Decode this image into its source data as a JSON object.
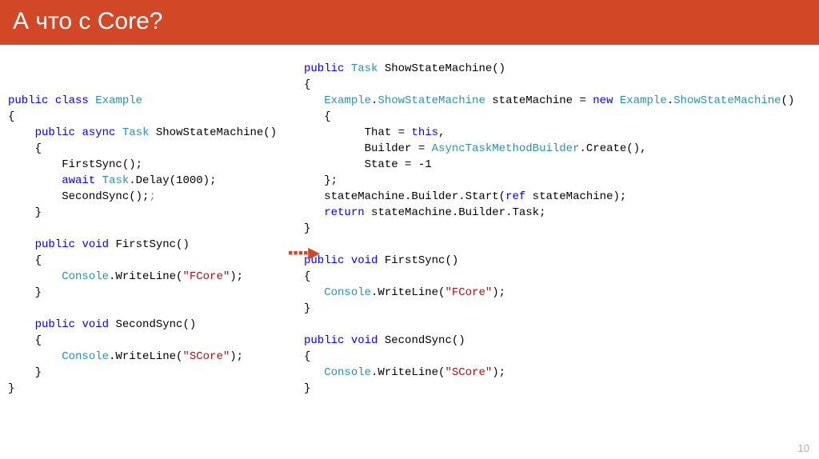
{
  "header": {
    "title": "А что с Core?"
  },
  "slide": {
    "page_number": "10"
  },
  "code": {
    "left": {
      "tokens": [
        {
          "t": "public",
          "c": "kw"
        },
        {
          "t": " "
        },
        {
          "t": "class",
          "c": "kw"
        },
        {
          "t": " "
        },
        {
          "t": "Example",
          "c": "type"
        },
        {
          "t": "\n"
        },
        {
          "t": "{\n"
        },
        {
          "t": "    "
        },
        {
          "t": "public",
          "c": "kw"
        },
        {
          "t": " "
        },
        {
          "t": "async",
          "c": "kw"
        },
        {
          "t": " "
        },
        {
          "t": "Task",
          "c": "type"
        },
        {
          "t": " ShowStateMachine()\n"
        },
        {
          "t": "    {\n"
        },
        {
          "t": "        FirstSync();\n"
        },
        {
          "t": "        "
        },
        {
          "t": "await",
          "c": "kw"
        },
        {
          "t": " "
        },
        {
          "t": "Task",
          "c": "type"
        },
        {
          "t": ".Delay(1000);\n"
        },
        {
          "t": "        SecondSync();"
        },
        {
          "t": ";",
          "c": "gray"
        },
        {
          "t": "\n"
        },
        {
          "t": "    }\n"
        },
        {
          "t": "\n"
        },
        {
          "t": "    "
        },
        {
          "t": "public",
          "c": "kw"
        },
        {
          "t": " "
        },
        {
          "t": "void",
          "c": "kw"
        },
        {
          "t": " FirstSync()\n"
        },
        {
          "t": "    {",
          "hl": true
        },
        {
          "t": "\n"
        },
        {
          "t": "        "
        },
        {
          "t": "Console",
          "c": "type"
        },
        {
          "t": ".WriteLine("
        },
        {
          "t": "\"FCore\"",
          "c": "str"
        },
        {
          "t": ");\n"
        },
        {
          "t": "    }\n"
        },
        {
          "t": "\n"
        },
        {
          "t": "    "
        },
        {
          "t": "public",
          "c": "kw"
        },
        {
          "t": " "
        },
        {
          "t": "void",
          "c": "kw"
        },
        {
          "t": " SecondSync()\n"
        },
        {
          "t": "    {\n"
        },
        {
          "t": "        "
        },
        {
          "t": "Console",
          "c": "type"
        },
        {
          "t": ".WriteLine("
        },
        {
          "t": "\"SCore\"",
          "c": "str"
        },
        {
          "t": ");\n"
        },
        {
          "t": "    }\n"
        },
        {
          "t": "}\n"
        }
      ]
    },
    "right": {
      "tokens": [
        {
          "t": "public",
          "c": "kw"
        },
        {
          "t": " "
        },
        {
          "t": "Task",
          "c": "type"
        },
        {
          "t": " ShowStateMachine()\n"
        },
        {
          "t": "{\n"
        },
        {
          "t": "   "
        },
        {
          "t": "Example",
          "c": "type"
        },
        {
          "t": "."
        },
        {
          "t": "ShowStateMachine",
          "c": "type"
        },
        {
          "t": " stateMachine = "
        },
        {
          "t": "new",
          "c": "kw"
        },
        {
          "t": " "
        },
        {
          "t": "Example",
          "c": "type"
        },
        {
          "t": "."
        },
        {
          "t": "ShowStateMachine",
          "c": "type"
        },
        {
          "t": "()\n"
        },
        {
          "t": "   {\n"
        },
        {
          "t": "         That = "
        },
        {
          "t": "this",
          "c": "kw"
        },
        {
          "t": ",\n"
        },
        {
          "t": "         Builder = "
        },
        {
          "t": "AsyncTaskMethodBuilder",
          "c": "type"
        },
        {
          "t": ".Create(),\n"
        },
        {
          "t": "         State = -1\n"
        },
        {
          "t": "   };\n"
        },
        {
          "t": "   stateMachine.Builder.Start("
        },
        {
          "t": "ref",
          "c": "kw"
        },
        {
          "t": " stateMachine);\n"
        },
        {
          "t": "   "
        },
        {
          "t": "return",
          "c": "kw"
        },
        {
          "t": " stateMachine.Builder.Task;\n"
        },
        {
          "t": "}\n"
        },
        {
          "t": "\n"
        },
        {
          "t": "public",
          "c": "kw"
        },
        {
          "t": " "
        },
        {
          "t": "void",
          "c": "kw"
        },
        {
          "t": " FirstSync()\n"
        },
        {
          "t": "{\n"
        },
        {
          "t": "   "
        },
        {
          "t": "Console",
          "c": "type"
        },
        {
          "t": ".WriteLine("
        },
        {
          "t": "\"FCore\"",
          "c": "str"
        },
        {
          "t": ");\n"
        },
        {
          "t": "}\n"
        },
        {
          "t": "\n"
        },
        {
          "t": "public",
          "c": "kw"
        },
        {
          "t": " "
        },
        {
          "t": "void",
          "c": "kw"
        },
        {
          "t": " SecondSync()\n"
        },
        {
          "t": "{\n"
        },
        {
          "t": "   "
        },
        {
          "t": "Console",
          "c": "type"
        },
        {
          "t": ".WriteLine("
        },
        {
          "t": "\"SCore\"",
          "c": "str"
        },
        {
          "t": ");\n"
        },
        {
          "t": "}\n"
        }
      ]
    }
  },
  "arrow": {
    "glyph_dots": "▪▪▪▪",
    "glyph_head": "▶"
  }
}
